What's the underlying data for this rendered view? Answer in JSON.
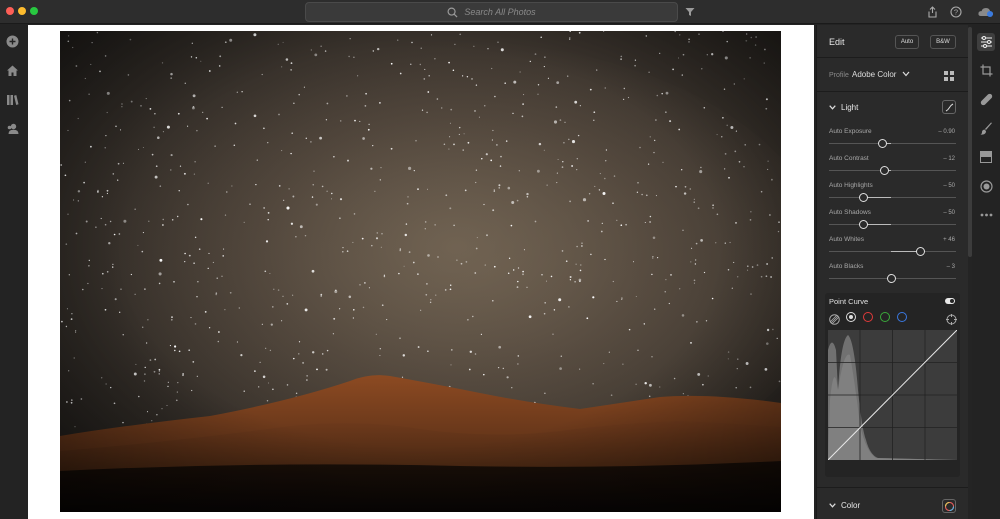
{
  "titlebar": {
    "search_placeholder": "Search All Photos",
    "traffic_colors": [
      "#fe5f57",
      "#febc2e",
      "#28c840"
    ]
  },
  "left_rail": {
    "icons": [
      "add-icon",
      "home-icon",
      "library-icon",
      "people-icon"
    ]
  },
  "right_rail": {
    "icons": [
      "edit-sliders-icon",
      "crop-icon",
      "healing-icon",
      "brush-icon",
      "linear-gradient-icon",
      "radial-gradient-icon",
      "more-icon"
    ]
  },
  "edit_panel": {
    "title": "Edit",
    "auto_label": "Auto",
    "bw_label": "B&W",
    "profile_label": "Profile",
    "profile_value": "Adobe Color",
    "light": {
      "title": "Light",
      "sliders": [
        {
          "label": "Auto Exposure",
          "value": "– 0.90",
          "position": 0.42
        },
        {
          "label": "Auto Contrast",
          "value": "– 12",
          "position": 0.44
        },
        {
          "label": "Auto Highlights",
          "value": "– 50",
          "position": 0.27
        },
        {
          "label": "Auto Shadows",
          "value": "– 50",
          "position": 0.27
        },
        {
          "label": "Auto Whites",
          "value": "+ 46",
          "position": 0.72
        },
        {
          "label": "Auto Blacks",
          "value": "– 3",
          "position": 0.49
        }
      ]
    },
    "point_curve": {
      "title": "Point Curve",
      "channel_colors": [
        "#ffffff",
        "#e03a3a",
        "#3aa83a",
        "#3a78e0"
      ]
    },
    "color": {
      "title": "Color"
    }
  },
  "accent": "#e8e8e8"
}
